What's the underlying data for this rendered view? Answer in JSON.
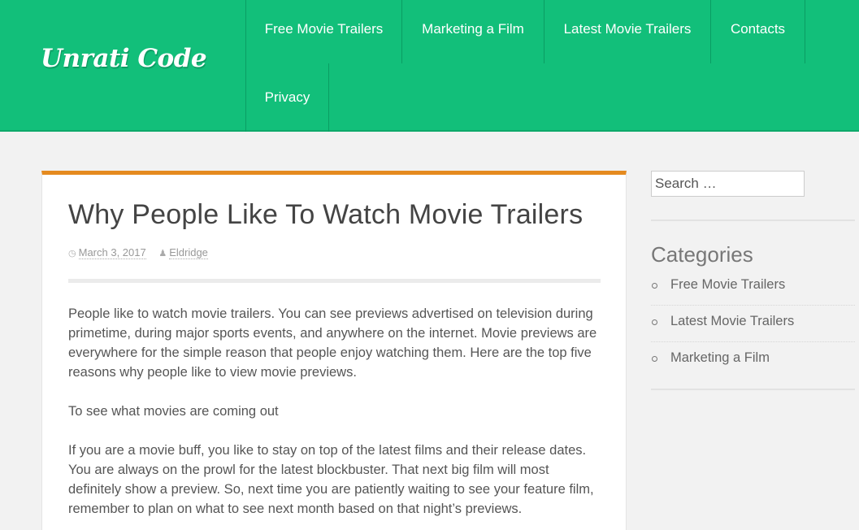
{
  "site": {
    "logo": "Unrati Code"
  },
  "nav": [
    {
      "label": "Free Movie Trailers"
    },
    {
      "label": "Marketing a Film"
    },
    {
      "label": "Latest Movie Trailers"
    },
    {
      "label": "Contacts"
    },
    {
      "label": "Privacy"
    }
  ],
  "article": {
    "title": "Why People Like To Watch Movie Trailers",
    "date": "March 3, 2017",
    "author": "Eldridge",
    "paragraphs": [
      "People like to watch movie trailers. You can see previews advertised on television during primetime, during major sports events, and anywhere on the internet. Movie previews are everywhere for the simple reason that people enjoy watching them. Here are the top five reasons why people like to view movie previews.",
      "To see what movies are coming out",
      "If you are a movie buff, you like to stay on top of the latest films and their release dates. You are always on the prowl for the latest blockbuster. That next big film will most definitely show a preview. So, next time you are patiently waiting to see your feature film, remember to plan on what to see next month based on that night’s previews."
    ]
  },
  "sidebar": {
    "search_placeholder": "Search …",
    "categories_title": "Categories",
    "categories": [
      {
        "label": "Free Movie Trailers"
      },
      {
        "label": "Latest Movie Trailers"
      },
      {
        "label": "Marketing a Film"
      }
    ]
  },
  "icons": {
    "date": "clock-icon",
    "author": "user-icon",
    "category_bullet": "circle-bullet-icon"
  },
  "colors": {
    "header": "#12bf7a",
    "article_accent": "#e58a1f",
    "background": "#f2f2f2"
  }
}
